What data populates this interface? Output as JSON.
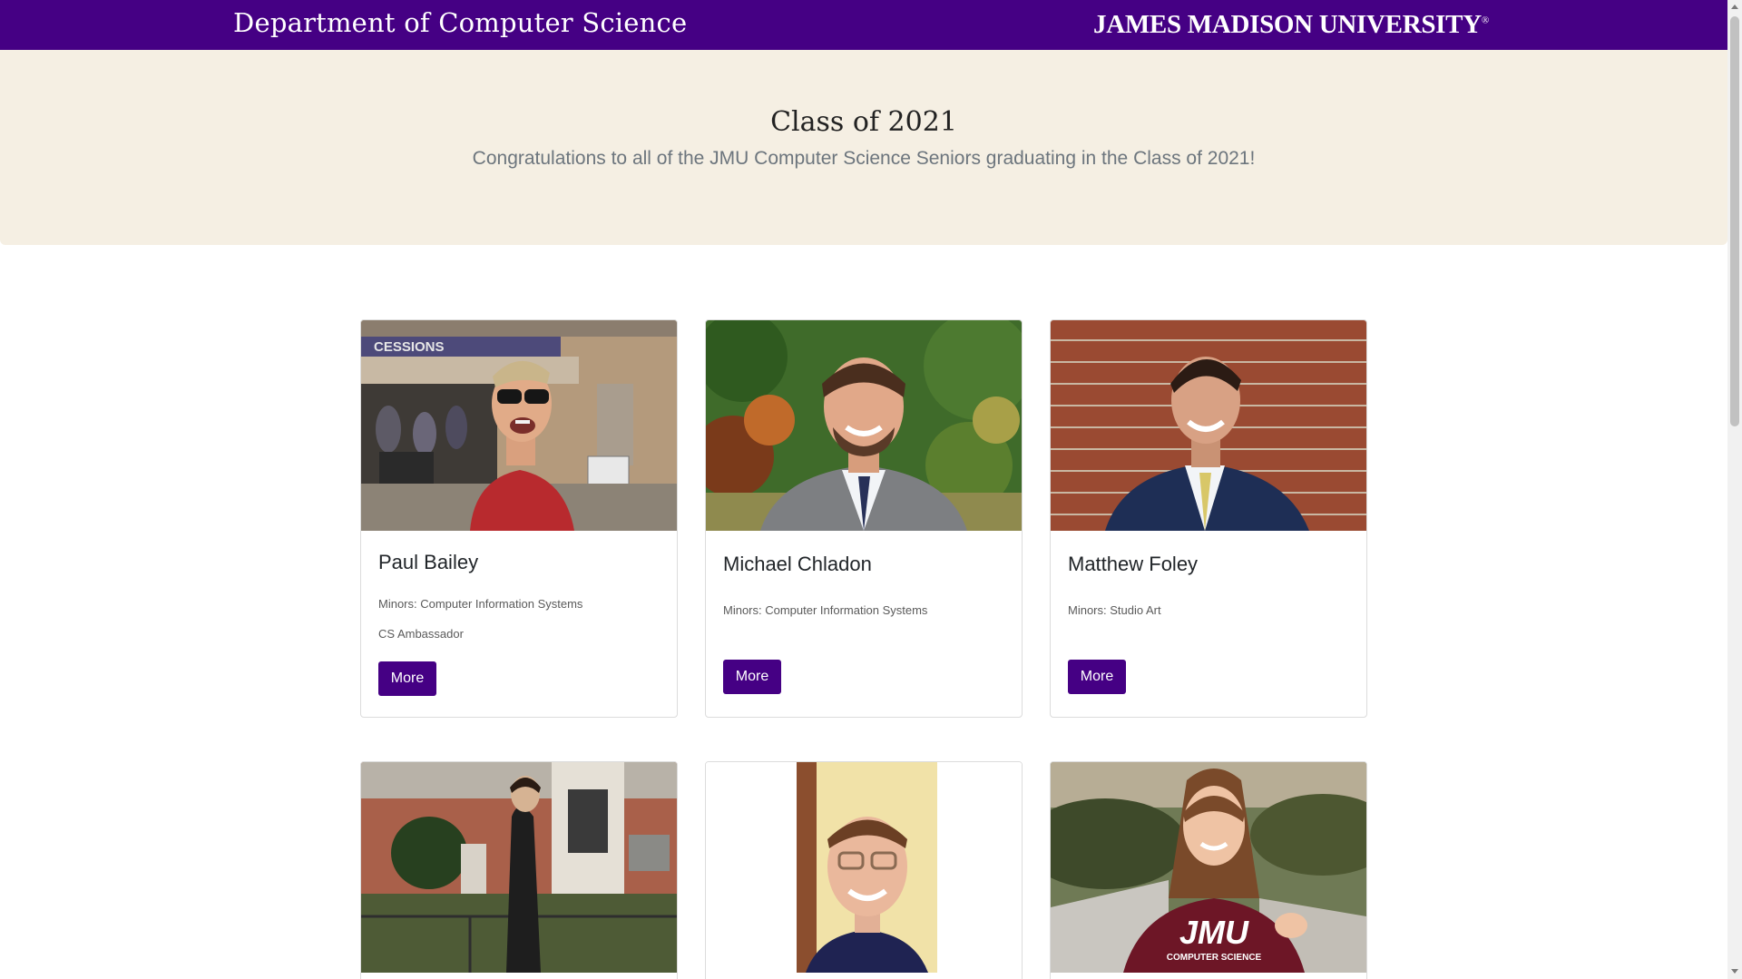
{
  "header": {
    "department": "Department of Computer Science",
    "university": "JAMES MADISON UNIVERSITY",
    "university_mark": "®"
  },
  "hero": {
    "title": "Class of 2021",
    "subtitle": "Congratulations to all of the JMU Computer Science Seniors graduating in the Class of 2021!"
  },
  "students": [
    {
      "name": "Paul Bailey",
      "minors": "Minors: Computer Information Systems",
      "extra": "CS Ambassador",
      "button": "More"
    },
    {
      "name": "Michael Chladon",
      "minors": "Minors: Computer Information Systems",
      "button": "More"
    },
    {
      "name": "Matthew Foley",
      "minors": "Minors: Studio Art",
      "button": "More"
    }
  ],
  "photo_text": {
    "jmu_shirt": "JMU",
    "shirt_subtext": "COMPUTER SCIENCE",
    "sign": "CESSIONS"
  },
  "colors": {
    "brand_purple": "#450084",
    "hero_bg": "#f5efe3"
  }
}
